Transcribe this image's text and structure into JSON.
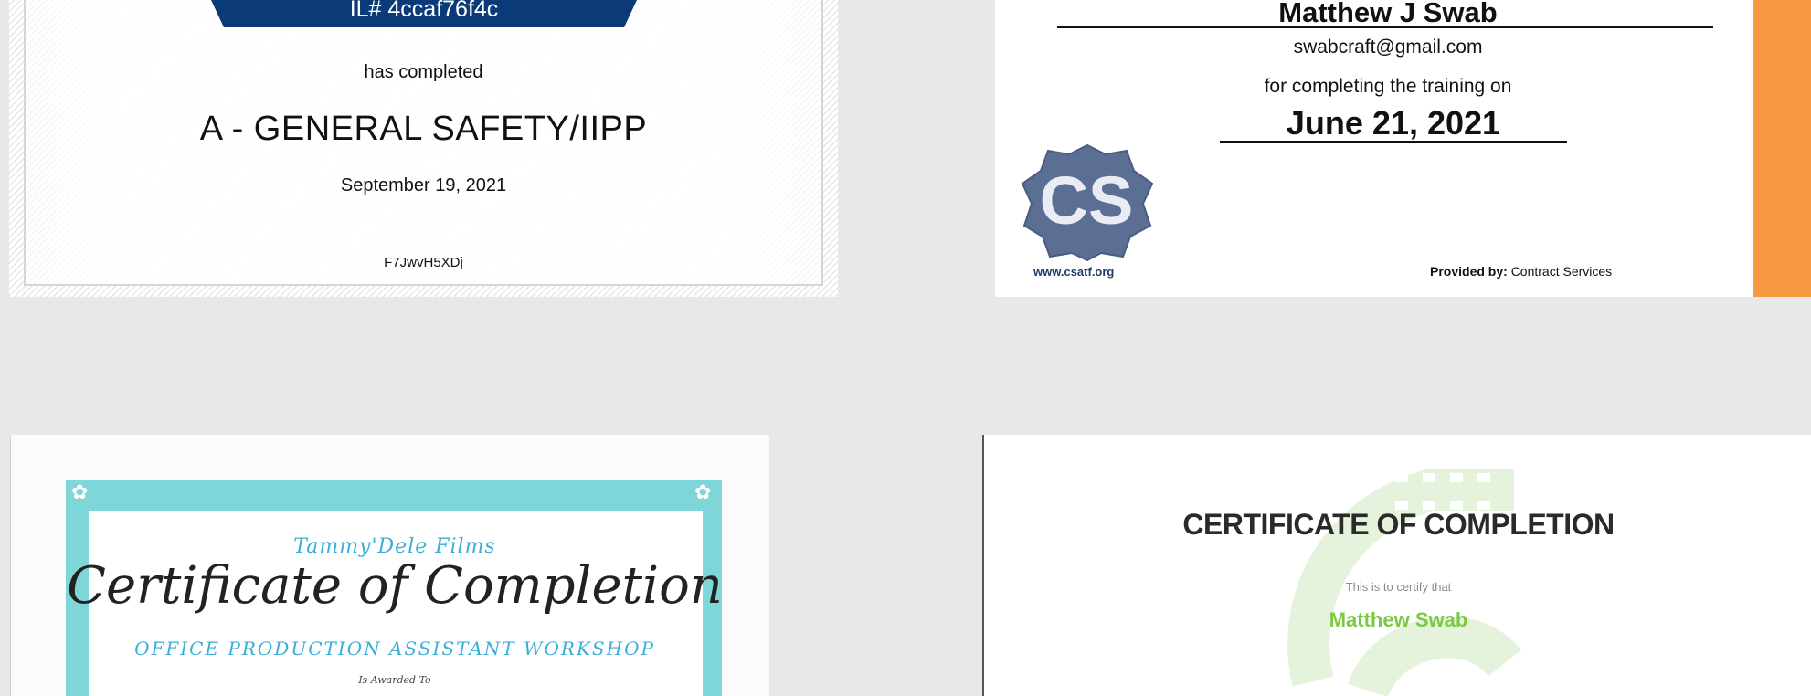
{
  "certificates": [
    {
      "id_text": "IL# 4ccaf76f4c",
      "completed_text": "has completed",
      "course": "A - GENERAL SAFETY/IIPP",
      "date": "September 19, 2021",
      "code": "F7JwvH5XDj",
      "colors": {
        "banner": "#0a3a78"
      }
    },
    {
      "name": "Matthew J Swab",
      "email": "swabcraft@gmail.com",
      "completing_text": "for completing the training on",
      "date": "June 21, 2021",
      "logo_text": "CS",
      "website": "www.csatf.org",
      "provided_by_label": "Provided by:",
      "provider": "Contract Services",
      "colors": {
        "accent_stripe": "#f79842",
        "logo": "#5b6f94"
      }
    },
    {
      "organization": "Tammy'Dele Films",
      "title": "Certificate of Completion",
      "workshop": "OFFICE PRODUCTION ASSISTANT WORKSHOP",
      "awarded_text": "Is Awarded To",
      "colors": {
        "border": "#7fd6d8",
        "accent": "#3aaed6"
      }
    },
    {
      "title": "CERTIFICATE OF COMPLETION",
      "certify_text": "This is to certify that",
      "name": "Matthew Swab",
      "colors": {
        "name": "#7ac943",
        "watermark": "#e6f3dc"
      }
    }
  ]
}
